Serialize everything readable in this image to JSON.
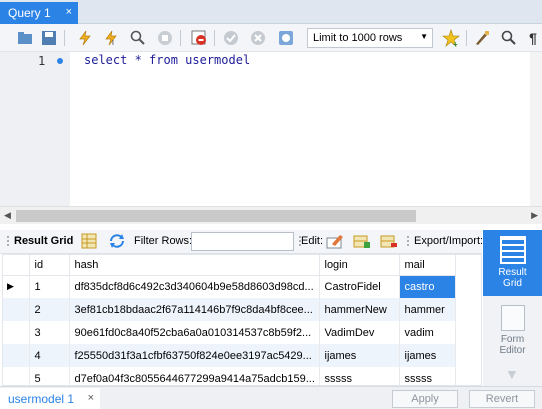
{
  "tabs": {
    "query_tab_label": "Query 1",
    "close_symbol": "×"
  },
  "toolbar": {
    "limit_select_value": "Limit to 1000 rows",
    "icons": [
      "open-folder-icon",
      "save-icon",
      "execute-icon",
      "execute-current-icon",
      "explain-icon",
      "stop-icon",
      "toggle-stop-on-error-icon",
      "commit-icon",
      "rollback-icon",
      "autocommit-icon",
      "add-snippet-icon",
      "beautify-icon",
      "find-icon",
      "invisible-chars-icon"
    ]
  },
  "editor": {
    "line_number": "1",
    "code": "select * from usermodel"
  },
  "result_toolbar": {
    "result_grid_label": "Result Grid",
    "filter_rows_label": "Filter Rows:",
    "edit_label": "Edit:",
    "export_import_label": "Export/Import:"
  },
  "grid": {
    "columns": [
      "id",
      "hash",
      "login",
      "mail"
    ],
    "rows": [
      [
        "1",
        "df835dcf8d6c492c3d340604b9e58d8603d98cd...",
        "CastroFidel",
        "castro"
      ],
      [
        "2",
        "3ef81cb18bdaac2f67a114146b7f9c8da4bf8cee...",
        "hammerNew",
        "hammer"
      ],
      [
        "3",
        "90e61fd0c8a40f52cba6a0a010314537c8b59f2...",
        "VadimDev",
        "vadim"
      ],
      [
        "4",
        "f25550d31f3a1cfbf63750f824e0ee3197ac5429...",
        "ijames",
        "ijames"
      ],
      [
        "5",
        "d7ef0a04f3c8055644677299a9414a75adcb159...",
        "sssss",
        "sssss"
      ]
    ],
    "row_marker": "▶"
  },
  "right_panel": {
    "result_grid_label_1": "Result",
    "result_grid_label_2": "Grid",
    "form_editor_label_1": "Form",
    "form_editor_label_2": "Editor"
  },
  "bottom": {
    "result_tab_label": "usermodel 1",
    "close_symbol": "×",
    "apply_label": "Apply",
    "revert_label": "Revert"
  },
  "colors": {
    "accent": "#2b83e6",
    "alt_row": "#eef4fc"
  }
}
